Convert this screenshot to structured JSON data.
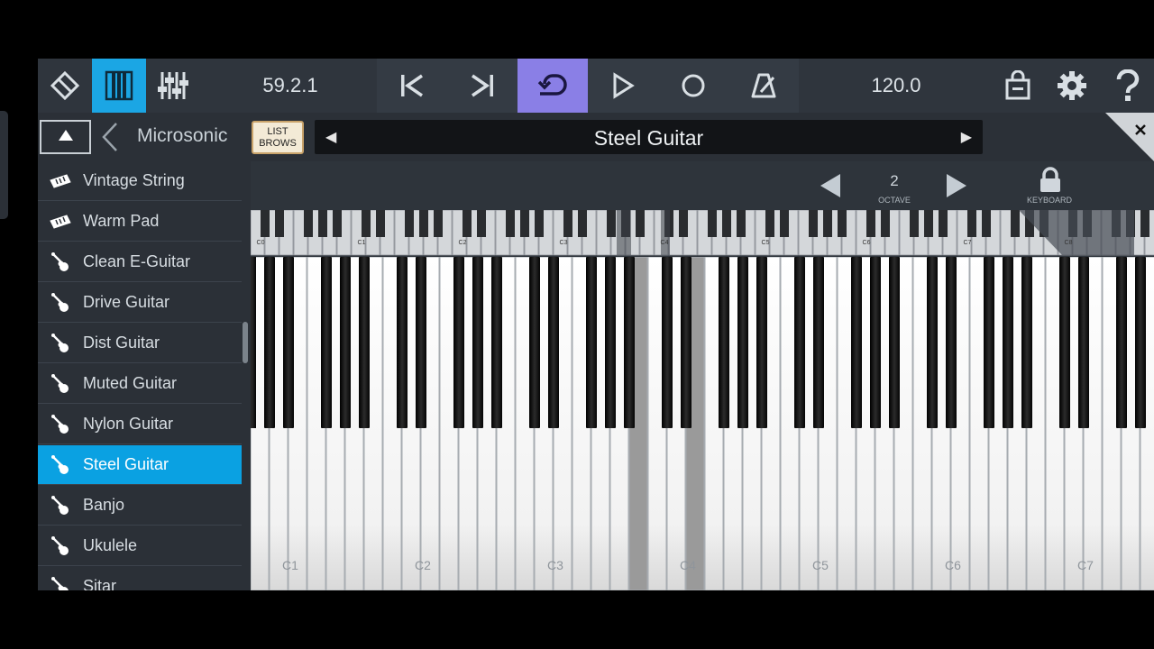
{
  "toolbar": {
    "position": "59.2.1",
    "tempo": "120.0",
    "buttons": [
      {
        "name": "project-icon",
        "active": false
      },
      {
        "name": "keyboard-view-icon",
        "active": true
      },
      {
        "name": "mixer-icon",
        "active": false
      },
      {
        "name": "skip-back-icon"
      },
      {
        "name": "skip-forward-icon"
      },
      {
        "name": "loop-icon",
        "active": true
      },
      {
        "name": "play-icon"
      },
      {
        "name": "record-icon"
      },
      {
        "name": "metronome-icon"
      },
      {
        "name": "store-bag-icon"
      },
      {
        "name": "gear-icon"
      },
      {
        "name": "help-icon"
      }
    ]
  },
  "browser": {
    "title": "Microsonic",
    "list_button": {
      "line1": "LIST",
      "line2": "BROWS"
    },
    "preset": "Steel Guitar",
    "items": [
      {
        "label": "Vintage String",
        "icon": "keyboard-instrument-icon",
        "selected": false
      },
      {
        "label": "Warm Pad",
        "icon": "keyboard-instrument-icon",
        "selected": false
      },
      {
        "label": "Clean E-Guitar",
        "icon": "guitar-icon",
        "selected": false
      },
      {
        "label": "Drive Guitar",
        "icon": "guitar-icon",
        "selected": false
      },
      {
        "label": "Dist Guitar",
        "icon": "guitar-icon",
        "selected": false
      },
      {
        "label": "Muted Guitar",
        "icon": "guitar-icon",
        "selected": false
      },
      {
        "label": "Nylon Guitar",
        "icon": "guitar-icon",
        "selected": false
      },
      {
        "label": "Steel Guitar",
        "icon": "guitar-icon",
        "selected": true
      },
      {
        "label": "Banjo",
        "icon": "guitar-icon",
        "selected": false
      },
      {
        "label": "Ukulele",
        "icon": "guitar-icon",
        "selected": false
      },
      {
        "label": "Sitar",
        "icon": "guitar-icon",
        "selected": false
      }
    ]
  },
  "octave": {
    "value": "2",
    "label": "OCTAVE",
    "keyboard_label": "KEYBOARD"
  },
  "mini_keyboard": {
    "labels": [
      "C0",
      "C1",
      "C2",
      "C3",
      "C4",
      "C5",
      "C6",
      "C7",
      "C8"
    ]
  },
  "main_keyboard": {
    "labels": [
      "C1",
      "C2",
      "C3",
      "C4",
      "C5",
      "C6",
      "C7"
    ]
  },
  "colors": {
    "accent_blue": "#1ba6e4",
    "loop_purple": "#8a7fe6",
    "selected_item": "#0aa1e2"
  }
}
